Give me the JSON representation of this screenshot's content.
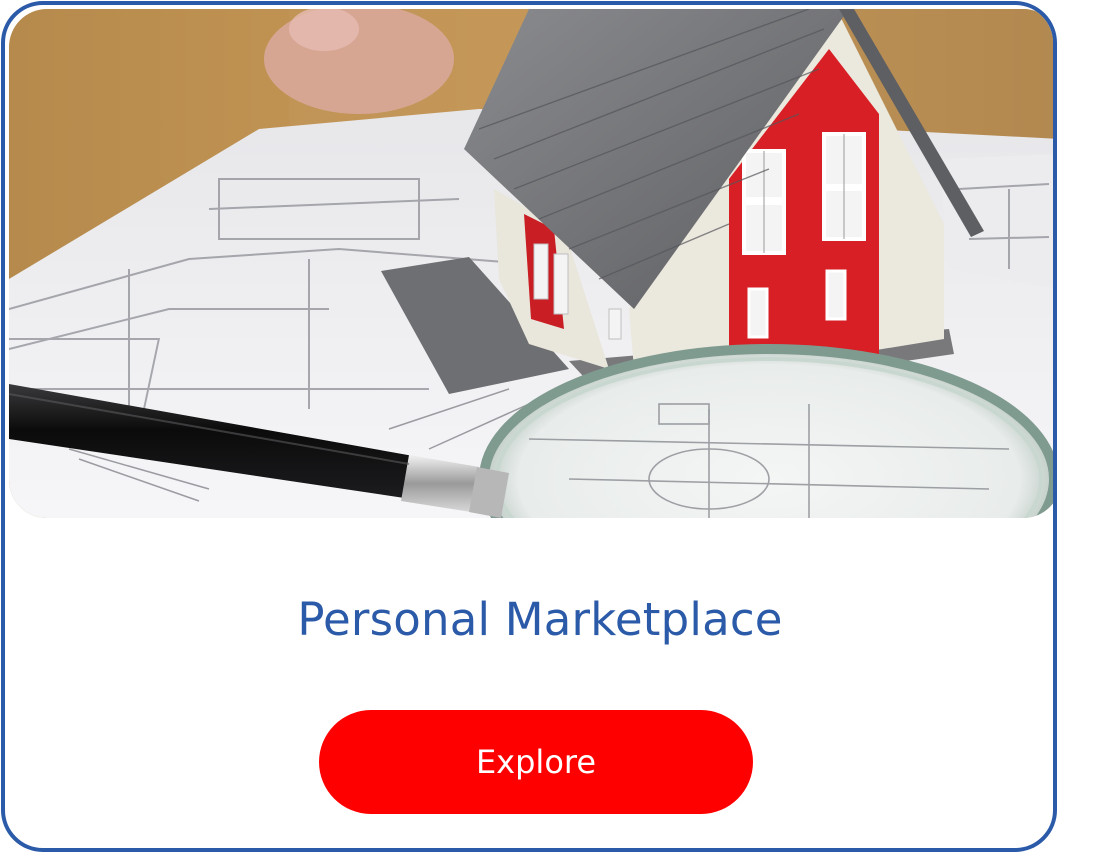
{
  "card": {
    "title": "Personal Marketplace",
    "button_label": "Explore",
    "image": {
      "subject": "model house on blueprints with pen and magnifying glass"
    }
  },
  "colors": {
    "accent_blue": "#2a5aa8",
    "button_red": "#fe0000",
    "house_red": "#d81f25",
    "roof_gray": "#6f7073"
  }
}
